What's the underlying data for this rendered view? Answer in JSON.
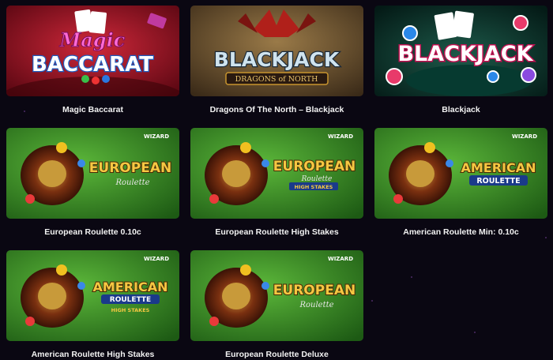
{
  "games": [
    {
      "title": "Magic Baccarat",
      "art": "magic-baccarat",
      "logo_lines": [
        "Magic",
        "BACCARAT"
      ]
    },
    {
      "title": "Dragons Of The North – Blackjack",
      "art": "dragons-blackjack",
      "logo_lines": [
        "BLACKJACK",
        "DRAGONS of NORTH"
      ]
    },
    {
      "title": "Blackjack",
      "art": "blackjack",
      "logo_lines": [
        "BLACKJACK"
      ]
    },
    {
      "title": "European Roulette 0.10c",
      "art": "european-roulette",
      "brand": "WIZARD",
      "logo_lines": [
        "EUROPEAN",
        "Roulette"
      ]
    },
    {
      "title": "European Roulette High Stakes",
      "art": "european-roulette-high",
      "brand": "WIZARD",
      "logo_lines": [
        "EUROPEAN",
        "Roulette",
        "HIGH STAKES"
      ]
    },
    {
      "title": "American Roulette Min: 0.10c",
      "art": "american-roulette",
      "brand": "WIZARD",
      "logo_lines": [
        "AMERICAN",
        "ROULETTE"
      ]
    },
    {
      "title": "American Roulette High Stakes",
      "art": "american-roulette-high",
      "brand": "WIZARD",
      "logo_lines": [
        "AMERICAN",
        "ROULETTE",
        "HIGH STAKES"
      ]
    },
    {
      "title": "European Roulette Deluxe",
      "art": "european-roulette",
      "brand": "WIZARD",
      "logo_lines": [
        "EUROPEAN",
        "Roulette"
      ]
    }
  ],
  "colors": {
    "page_bg": "#0a0712",
    "title_text": "#f2f2f2",
    "roulette_green": "#3f8f2a",
    "baccarat_red": "#9a1020",
    "dragon_gold": "#c8942e"
  }
}
